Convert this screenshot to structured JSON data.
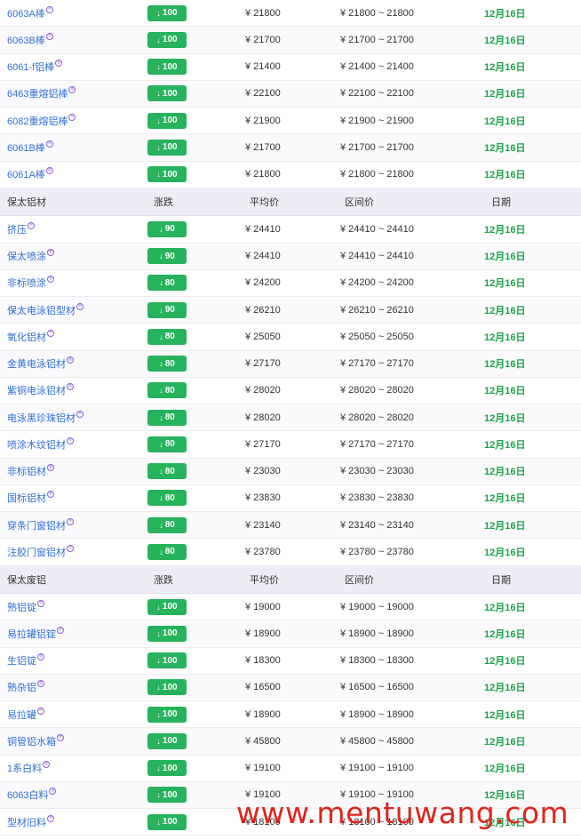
{
  "header": {
    "col_change": "涨跌",
    "col_avg": "平均价",
    "col_range": "区间价",
    "col_date": "日期"
  },
  "currency": "¥",
  "range_sep": "~",
  "watermark_site": "www.mentuwang.com",
  "section1": {
    "rows": [
      {
        "name": "6063A棒",
        "change": "100",
        "avg": "21800",
        "low": "21800",
        "high": "21800",
        "date": "12月16日"
      },
      {
        "name": "6063B棒",
        "change": "100",
        "avg": "21700",
        "low": "21700",
        "high": "21700",
        "date": "12月16日"
      },
      {
        "name": "6061-f铝棒",
        "change": "100",
        "avg": "21400",
        "low": "21400",
        "high": "21400",
        "date": "12月16日"
      },
      {
        "name": "6463重熔铝棒",
        "change": "100",
        "avg": "22100",
        "low": "22100",
        "high": "22100",
        "date": "12月16日"
      },
      {
        "name": "6082重熔铝棒",
        "change": "100",
        "avg": "21900",
        "low": "21900",
        "high": "21900",
        "date": "12月16日"
      },
      {
        "name": "6061B棒",
        "change": "100",
        "avg": "21700",
        "low": "21700",
        "high": "21700",
        "date": "12月16日"
      },
      {
        "name": "6061A棒",
        "change": "100",
        "avg": "21800",
        "low": "21800",
        "high": "21800",
        "date": "12月16日"
      }
    ]
  },
  "section2": {
    "title": "保太铝材",
    "rows": [
      {
        "name": "挤压",
        "change": "90",
        "avg": "24410",
        "low": "24410",
        "high": "24410",
        "date": "12月16日"
      },
      {
        "name": "保太喷涂",
        "change": "90",
        "avg": "24410",
        "low": "24410",
        "high": "24410",
        "date": "12月16日"
      },
      {
        "name": "非标喷涂",
        "change": "80",
        "avg": "24200",
        "low": "24200",
        "high": "24200",
        "date": "12月16日"
      },
      {
        "name": "保太电泳铝型材",
        "change": "90",
        "avg": "26210",
        "low": "26210",
        "high": "26210",
        "date": "12月16日"
      },
      {
        "name": "氧化铝材",
        "change": "80",
        "avg": "25050",
        "low": "25050",
        "high": "25050",
        "date": "12月16日"
      },
      {
        "name": "金黄电泳铝材",
        "change": "80",
        "avg": "27170",
        "low": "27170",
        "high": "27170",
        "date": "12月16日"
      },
      {
        "name": "紫铜电泳铝材",
        "change": "80",
        "avg": "28020",
        "low": "28020",
        "high": "28020",
        "date": "12月16日"
      },
      {
        "name": "电泳黑珍珠铝材",
        "change": "80",
        "avg": "28020",
        "low": "28020",
        "high": "28020",
        "date": "12月16日"
      },
      {
        "name": "喷涂木纹铝材",
        "change": "80",
        "avg": "27170",
        "low": "27170",
        "high": "27170",
        "date": "12月16日"
      },
      {
        "name": "非标铝材",
        "change": "80",
        "avg": "23030",
        "low": "23030",
        "high": "23030",
        "date": "12月16日"
      },
      {
        "name": "国标铝材",
        "change": "80",
        "avg": "23830",
        "low": "23830",
        "high": "23830",
        "date": "12月16日"
      },
      {
        "name": "穿条门窗铝材",
        "change": "80",
        "avg": "23140",
        "low": "23140",
        "high": "23140",
        "date": "12月16日"
      },
      {
        "name": "注胶门窗铝材",
        "change": "80",
        "avg": "23780",
        "low": "23780",
        "high": "23780",
        "date": "12月16日"
      }
    ]
  },
  "section3": {
    "title": "保太废铝",
    "rows": [
      {
        "name": "熟铝锭",
        "change": "100",
        "avg": "19000",
        "low": "19000",
        "high": "19000",
        "date": "12月16日"
      },
      {
        "name": "易拉罐铝锭",
        "change": "100",
        "avg": "18900",
        "low": "18900",
        "high": "18900",
        "date": "12月16日"
      },
      {
        "name": "生铝锭",
        "change": "100",
        "avg": "18300",
        "low": "18300",
        "high": "18300",
        "date": "12月16日"
      },
      {
        "name": "熟杂铝",
        "change": "100",
        "avg": "16500",
        "low": "16500",
        "high": "16500",
        "date": "12月16日"
      },
      {
        "name": "易拉罐",
        "change": "100",
        "avg": "18900",
        "low": "18900",
        "high": "18900",
        "date": "12月16日"
      },
      {
        "name": "铜管铝水箱",
        "change": "100",
        "avg": "45800",
        "low": "45800",
        "high": "45800",
        "date": "12月16日"
      },
      {
        "name": "1系白料",
        "change": "100",
        "avg": "19100",
        "low": "19100",
        "high": "19100",
        "date": "12月16日"
      },
      {
        "name": "6063白料",
        "change": "100",
        "avg": "19100",
        "low": "19100",
        "high": "19100",
        "date": "12月16日"
      },
      {
        "name": "型材旧料",
        "change": "100",
        "avg": "18100",
        "low": "18100",
        "high": "18100",
        "date": "12月16日"
      }
    ]
  },
  "colors": {
    "badge_green": "#26b35c",
    "date_green": "#1aa34a",
    "link_blue": "#2f6fd3",
    "header_bg": "#eeedf6",
    "watermark_red": "#e0241b"
  },
  "icons": {
    "down_arrow": "↓",
    "registered": "®"
  }
}
